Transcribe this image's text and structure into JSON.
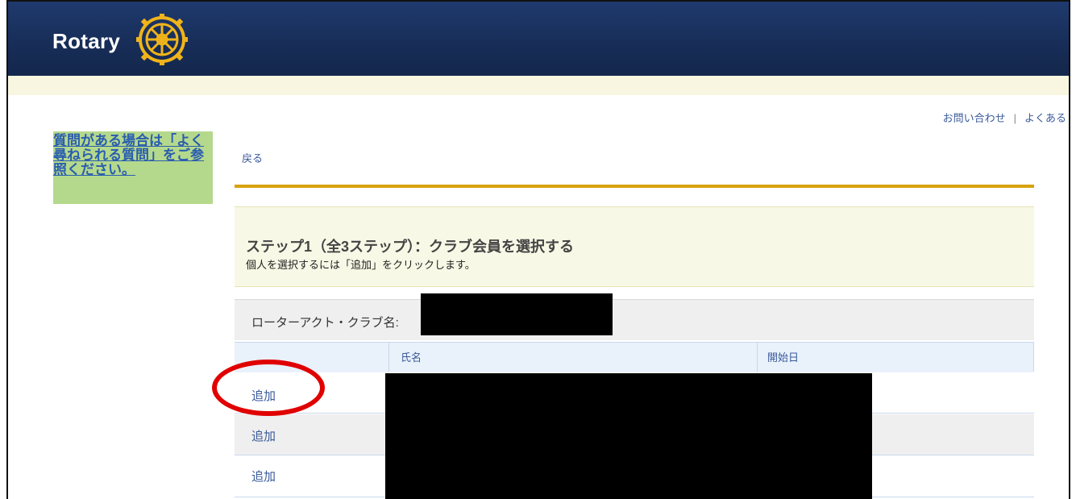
{
  "header": {
    "logo_text": "Rotary",
    "brand_color": "#1a3263",
    "wheel_color": "#f0b41a"
  },
  "utility_nav": {
    "contact": "お問い合わせ",
    "separator": "|",
    "faq": "よくある"
  },
  "sidebar": {
    "help_text": "質問がある場合は「よく尋ねられる質問」をご参照ください。"
  },
  "main": {
    "back_label": "戻る",
    "step_title": "ステップ1（全3ステップ）：クラブ会員を選択する",
    "step_subtitle": "個人を選択するには「追加」をクリックします。",
    "club_label": "ローターアクト・クラブ名:",
    "table": {
      "columns": [
        "",
        "氏名",
        "開始日"
      ],
      "rows": [
        {
          "action": "追加"
        },
        {
          "action": "追加"
        },
        {
          "action": "追加"
        }
      ]
    }
  },
  "annotation": {
    "highlight_color": "#e00000"
  }
}
